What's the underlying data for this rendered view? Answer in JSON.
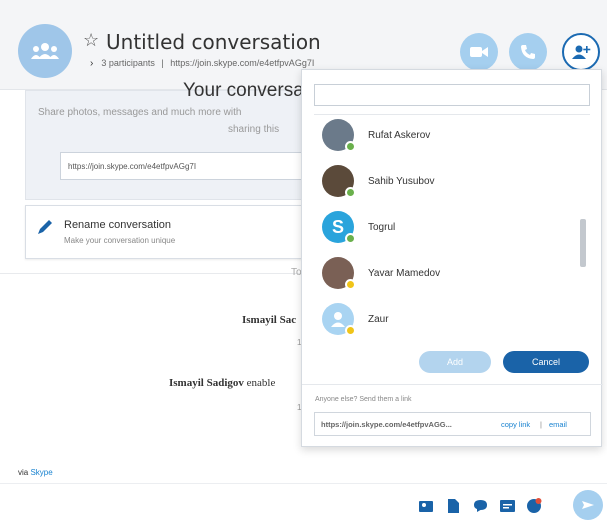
{
  "header": {
    "title": "Untitled conversation",
    "participants": "3 participants",
    "link": "https://join.skype.com/e4etfpvAGg7I"
  },
  "share_card": {
    "title": "Your conversa",
    "subtitle": "Share photos, messages and much more with",
    "subtitle2": "sharing this",
    "link": "https://join.skype.com/e4etfpvAGg7I"
  },
  "rename": {
    "title": "Rename conversation",
    "subtitle": "Make your conversation unique"
  },
  "chat": {
    "day_label": "To",
    "msg1_name": "Ismayil Sac",
    "msg1_time": "1",
    "msg2_name": "Ismayil Sadigov",
    "msg2_text": "enable",
    "msg2_time": "1",
    "via_prefix": "via",
    "via_link": "Skype"
  },
  "add_people": {
    "search_placeholder": "",
    "contacts": [
      {
        "name": "Rufat Askerov",
        "status": "online"
      },
      {
        "name": "Sahib Yusubov",
        "status": "online"
      },
      {
        "name": "Togrul",
        "status": "online"
      },
      {
        "name": "Yavar Mamedov",
        "status": "away"
      },
      {
        "name": "Zaur",
        "status": "away"
      }
    ],
    "add_label": "Add",
    "cancel_label": "Cancel",
    "anyone_else": "Anyone else? Send them a link",
    "share_link": "https://join.skype.com/e4etfpvAGG...",
    "copy_link": "copy link",
    "separator": "|",
    "email": "email"
  },
  "colors": {
    "accent": "#1a63a8",
    "light_accent": "#a5cfef",
    "online": "#6ab04c",
    "away": "#f0c419"
  }
}
